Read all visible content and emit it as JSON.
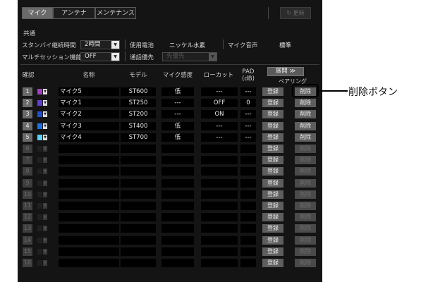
{
  "tabs": [
    "マイク",
    "アンテナ",
    "メンテナンス"
  ],
  "update_label": "更新",
  "common": {
    "heading": "共通",
    "standby_label": "スタンバイ継続時間",
    "standby_value": "2時間",
    "battery_label": "使用電池",
    "battery_value": "ニッケル水素",
    "mic_sound_label": "マイク音声",
    "mic_sound_value": "標準",
    "multi_label": "マルチセッション機能",
    "multi_value": "OFF",
    "priority_label": "通話優先",
    "priority_value": "先優先"
  },
  "table": {
    "headers": {
      "confirm": "確認",
      "name": "名称",
      "model": "モデル",
      "sensitivity": "マイク感度",
      "lowcut": "ローカット",
      "pad_line1": "PAD",
      "pad_line2": "(dB)",
      "expand": "展開 ≫",
      "pairing": "ペアリング"
    },
    "register_label": "登録",
    "delete_label": "削除",
    "rows": [
      {
        "num": "1",
        "color": "#a040c0",
        "name": "マイク5",
        "model": "ST600",
        "sens": "低",
        "lowcut": "---",
        "pad": "---"
      },
      {
        "num": "2",
        "color": "#6040d0",
        "name": "マイク1",
        "model": "ST250",
        "sens": "---",
        "lowcut": "OFF",
        "pad": "0"
      },
      {
        "num": "3",
        "color": "#2050d0",
        "name": "マイク2",
        "model": "ST200",
        "sens": "---",
        "lowcut": "ON",
        "pad": "---"
      },
      {
        "num": "4",
        "color": "#2070e0",
        "name": "マイク3",
        "model": "ST400",
        "sens": "低",
        "lowcut": "---",
        "pad": "---"
      },
      {
        "num": "5",
        "color": "#60d0f0",
        "name": "マイク4",
        "model": "ST700",
        "sens": "低",
        "lowcut": "---",
        "pad": "---"
      },
      {
        "num": "6"
      },
      {
        "num": "7"
      },
      {
        "num": "8"
      },
      {
        "num": "9"
      },
      {
        "num": "10"
      },
      {
        "num": "11"
      },
      {
        "num": "12"
      },
      {
        "num": "13"
      },
      {
        "num": "14"
      },
      {
        "num": "15"
      },
      {
        "num": "16"
      }
    ]
  },
  "callout": "削除ボタン"
}
